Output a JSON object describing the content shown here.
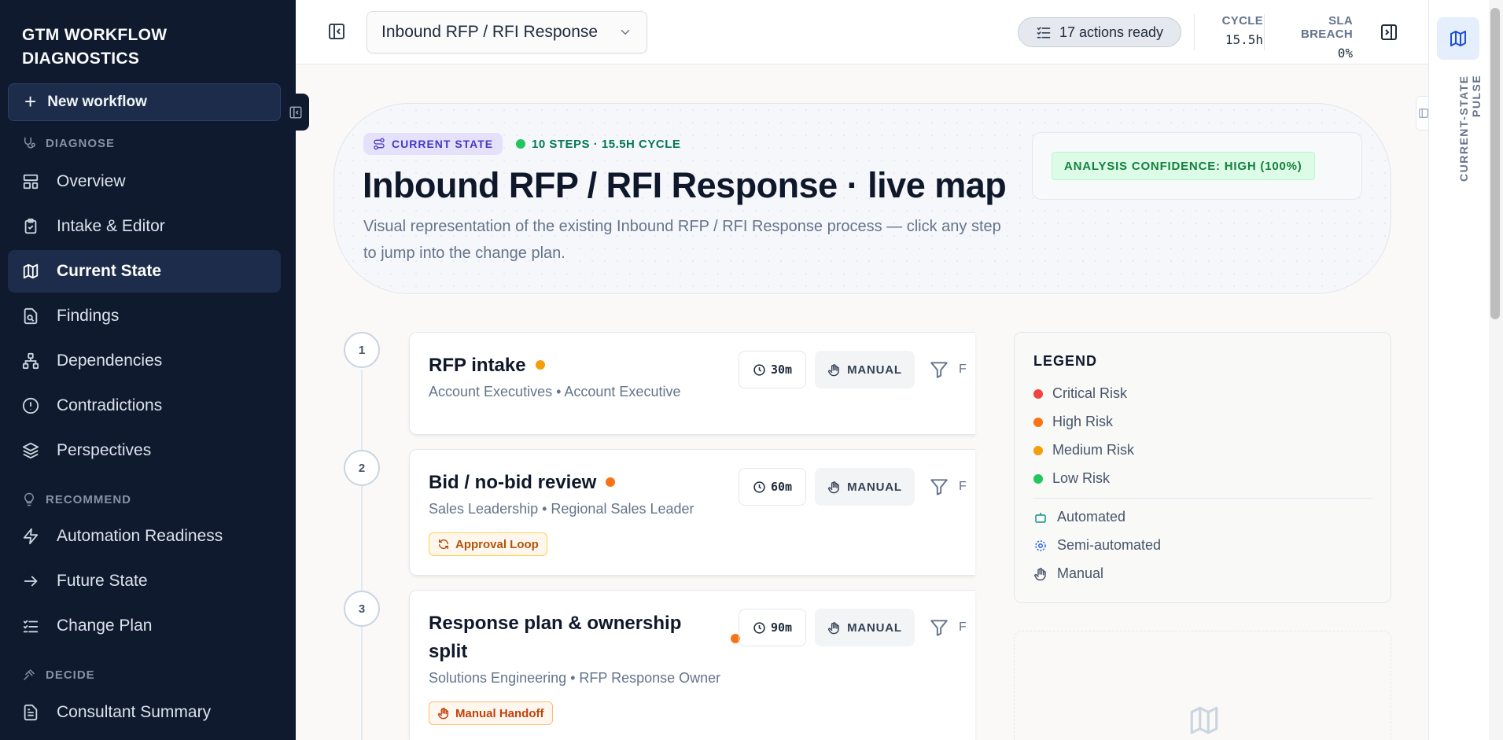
{
  "app": {
    "brand": "GTM WORKFLOW\nDIAGNOSTICS",
    "new_workflow": "New workflow"
  },
  "sidebar": {
    "sections": {
      "diagnose": "DIAGNOSE",
      "recommend": "RECOMMEND",
      "decide": "DECIDE"
    },
    "items": [
      {
        "label": "Overview",
        "icon": "layout-icon"
      },
      {
        "label": "Intake & Editor",
        "icon": "clipboard-icon"
      },
      {
        "label": "Current State",
        "icon": "map-icon",
        "active": true
      },
      {
        "label": "Findings",
        "icon": "file-search-icon"
      },
      {
        "label": "Dependencies",
        "icon": "network-icon"
      },
      {
        "label": "Contradictions",
        "icon": "alert-circle-icon"
      },
      {
        "label": "Perspectives",
        "icon": "layers-icon"
      },
      {
        "label": "Automation Readiness",
        "icon": "zap-icon"
      },
      {
        "label": "Future State",
        "icon": "arrow-right-icon"
      },
      {
        "label": "Change Plan",
        "icon": "list-checks-icon"
      },
      {
        "label": "Consultant Summary",
        "icon": "file-text-icon"
      }
    ]
  },
  "topbar": {
    "workflow_select": "Inbound RFP / RFI Response",
    "actions_ready": "17 actions ready",
    "cycle_label": "CYCLE",
    "cycle_value": "15.5h",
    "sla_label": "SLA BREACH",
    "sla_value": "0%"
  },
  "rail": {
    "label": "CURRENT-STATE PULSE"
  },
  "hero": {
    "tag": "CURRENT STATE",
    "steps_meta": "10 STEPS · 15.5H CYCLE",
    "title": "Inbound RFP / RFI Response · live map",
    "description": "Visual representation of the existing Inbound RFP / RFI Response process — click any step to jump into the change plan.",
    "confidence": "ANALYSIS CONFIDENCE: HIGH (100%)"
  },
  "steps": [
    {
      "num": "1",
      "title": "RFP intake",
      "risk_color": "#f59e0b",
      "subtitle": "Account Executives • Account Executive",
      "time": "30m",
      "mode": "MANUAL",
      "filter_text": "F",
      "tag": ""
    },
    {
      "num": "2",
      "title": "Bid / no-bid review",
      "risk_color": "#f97316",
      "subtitle": "Sales Leadership • Regional Sales Leader",
      "time": "60m",
      "mode": "MANUAL",
      "filter_text": "F",
      "tag": "Approval Loop"
    },
    {
      "num": "3",
      "title": "Response plan & ownership split",
      "risk_color": "#f97316",
      "subtitle": "Solutions Engineering • RFP Response Owner",
      "time": "90m",
      "mode": "MANUAL",
      "filter_text": "F",
      "tag": "Manual Handoff"
    }
  ],
  "legend": {
    "title": "LEGEND",
    "risks": [
      {
        "label": "Critical Risk",
        "color": "#ef4444"
      },
      {
        "label": "High Risk",
        "color": "#f97316"
      },
      {
        "label": "Medium Risk",
        "color": "#f59e0b"
      },
      {
        "label": "Low Risk",
        "color": "#22c55e"
      }
    ],
    "modes": [
      {
        "label": "Automated",
        "icon": "bot-icon"
      },
      {
        "label": "Semi-automated",
        "icon": "cog-icon"
      },
      {
        "label": "Manual",
        "icon": "hand-icon"
      }
    ]
  }
}
